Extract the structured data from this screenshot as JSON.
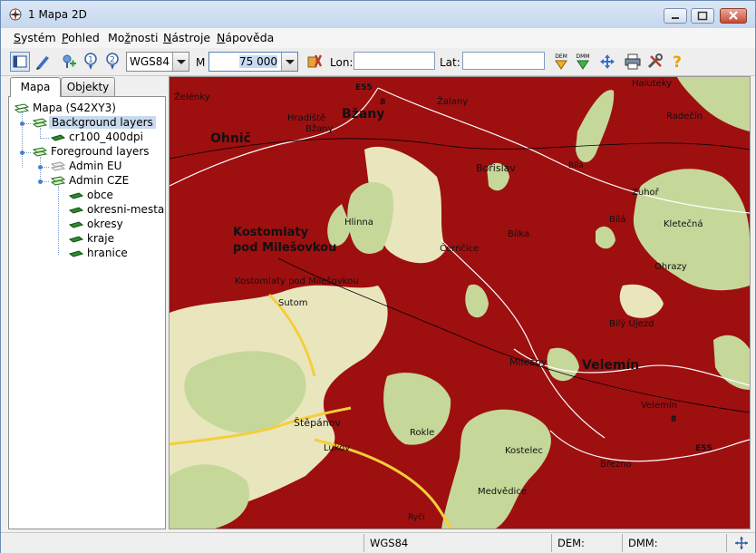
{
  "window": {
    "title": "1 Mapa 2D",
    "icon": "compass-icon",
    "controls": [
      "minimize-icon",
      "maximize-icon",
      "close-icon"
    ]
  },
  "menu": [
    {
      "pre": "",
      "mnem": "S",
      "post": "ystém"
    },
    {
      "pre": "",
      "mnem": "P",
      "post": "ohled"
    },
    {
      "pre": "Mo",
      "mnem": "ž",
      "post": "nosti"
    },
    {
      "pre": "",
      "mnem": "N",
      "post": "ástroje"
    },
    {
      "pre": "",
      "mnem": "N",
      "post": "ápověda"
    }
  ],
  "toolbar": {
    "crs_value": "WGS84",
    "scale_label": "M",
    "scale_value": "75 000",
    "lon_label": "Lon:",
    "lon_value": "",
    "lat_label": "Lat:",
    "lat_value": "",
    "dem_label": "DEM",
    "dmm_label": "DMM",
    "icons": [
      "panel-toggle-icon",
      "pen-icon",
      "add-layer-icon",
      "marker-1-icon",
      "marker-2-icon",
      "clear-icon",
      "dem-icon",
      "dmm-icon",
      "move-icon",
      "print-icon",
      "tools-icon",
      "help-icon"
    ]
  },
  "tabs": [
    "Mapa",
    "Objekty"
  ],
  "tree": {
    "root": "Mapa (S42XY3)",
    "background": "Background layers",
    "cr100": "cr100_400dpi",
    "foreground": "Foreground layers",
    "admin_eu": "Admin EU",
    "admin_cze": "Admin CZE",
    "leaves": [
      "obce",
      "okresni-mesta",
      "okresy",
      "kraje",
      "hranice"
    ]
  },
  "map": {
    "colors": {
      "forest": "#9e0f10",
      "farmland": "#e9e6be",
      "meadow": "#c6d79a",
      "road": "#f4cf3a"
    },
    "places": [
      {
        "name": "Bžany",
        "size": 14,
        "bold": true
      },
      {
        "name": "Ohnič",
        "size": 14,
        "bold": true
      },
      {
        "name": "Kostomlaty",
        "size": 13,
        "bold": true
      },
      {
        "name": "pod Milešovkou",
        "size": 13,
        "bold": true
      },
      {
        "name": "Kostomlaty pod Milešovkou",
        "size": 10,
        "bold": false
      },
      {
        "name": "Bořislav",
        "size": 11,
        "bold": false
      },
      {
        "name": "Hlinna",
        "size": 10,
        "bold": false
      },
      {
        "name": "Bílka",
        "size": 10,
        "bold": false
      },
      {
        "name": "Černčice",
        "size": 10,
        "bold": false
      },
      {
        "name": "Kletečná",
        "size": 10,
        "bold": false
      },
      {
        "name": "Milešov",
        "size": 11,
        "bold": false
      },
      {
        "name": "Velemín",
        "size": 14,
        "bold": true
      },
      {
        "name": "Štěpánov",
        "size": 11,
        "bold": false
      },
      {
        "name": "Lukov",
        "size": 10,
        "bold": false
      },
      {
        "name": "Medvědice",
        "size": 10,
        "bold": false
      },
      {
        "name": "Žalany",
        "size": 10,
        "bold": false
      },
      {
        "name": "Hradiště",
        "size": 10,
        "bold": false
      },
      {
        "name": "Bžany",
        "size": 10,
        "bold": false
      },
      {
        "name": "Želénky",
        "size": 10,
        "bold": false
      },
      {
        "name": "Radečín",
        "size": 10,
        "bold": false
      },
      {
        "name": "Haluteky",
        "size": 10,
        "bold": false
      },
      {
        "name": "Zuhoř",
        "size": 10,
        "bold": false
      },
      {
        "name": "Bílý Újezd",
        "size": 10,
        "bold": false
      },
      {
        "name": "Kostelec",
        "size": 10,
        "bold": false
      },
      {
        "name": "Březno",
        "size": 10,
        "bold": false
      },
      {
        "name": "Ohrazy",
        "size": 10,
        "bold": false
      },
      {
        "name": "Bílá",
        "size": 10,
        "bold": false
      },
      {
        "name": "Sutom",
        "size": 10,
        "bold": false
      },
      {
        "name": "Velemín",
        "size": 10,
        "bold": false
      },
      {
        "name": "Rokle",
        "size": 10,
        "bold": false
      },
      {
        "name": "E55",
        "size": 9,
        "bold": true
      },
      {
        "name": "E55",
        "size": 9,
        "bold": true
      },
      {
        "name": "8",
        "size": 9,
        "bold": true
      },
      {
        "name": "8",
        "size": 9,
        "bold": true
      },
      {
        "name": "Ryčí",
        "size": 9,
        "bold": false
      },
      {
        "name": "Bílá",
        "size": 9,
        "bold": false
      }
    ]
  },
  "status": {
    "empty": "",
    "crs": "WGS84",
    "dem": "DEM:",
    "dmm": "DMM:",
    "resize_icon": "size-grip-icon"
  }
}
